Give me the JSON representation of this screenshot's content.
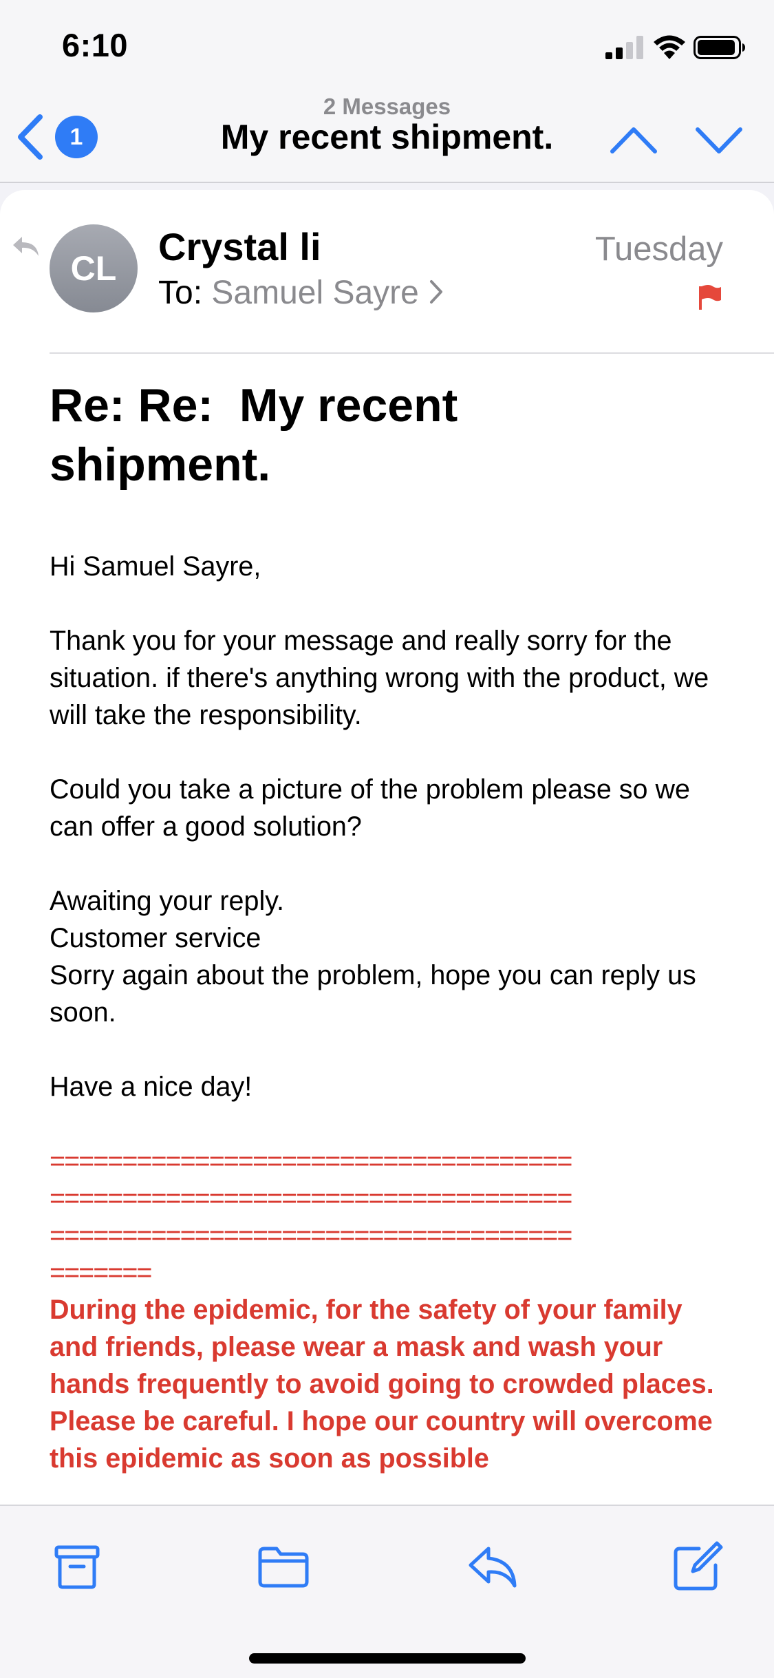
{
  "status_bar": {
    "time": "6:10",
    "signal_icon": "cellular-signal-icon",
    "wifi_icon": "wifi-icon",
    "battery_icon": "battery-icon"
  },
  "nav": {
    "back_badge": "1",
    "subtitle": "2 Messages",
    "title": "My recent shipment.",
    "up_icon": "chevron-up-icon",
    "down_icon": "chevron-down-icon"
  },
  "message": {
    "avatar_initials": "CL",
    "sender": "Crystal li",
    "to_label": "To: ",
    "recipient": "Samuel Sayre",
    "date": "Tuesday",
    "flagged": true,
    "subject": "Re: Re:  My recent shipment.",
    "body": {
      "greeting": "Hi Samuel Sayre,",
      "para1": "Thank you for your message and really sorry for the situation. if there's anything wrong with the product, we will take the responsibility.",
      "para2": "Could you take a picture of the problem please so we can offer a good solution?",
      "line_awaiting": "Awaiting your reply.",
      "line_service": "Customer service",
      "line_sorry": "Sorry again about the problem, hope you can reply us soon.",
      "sign_off": "Have a nice day!",
      "separator_1": "====================================",
      "separator_2": "====================================",
      "separator_3": "====================================",
      "separator_4": "=======",
      "epidemic_note": "During the epidemic, for the safety of your family and friends, please wear a mask and wash your hands frequently to avoid going to crowded places. Please be careful. I hope our country will overcome this epidemic as soon as possible"
    }
  },
  "toolbar": {
    "archive_icon": "archive-icon",
    "move_icon": "folder-icon",
    "reply_icon": "reply-icon",
    "compose_icon": "compose-icon"
  },
  "colors": {
    "accent": "#2f7cf6",
    "flag": "#e5483b",
    "quote_red": "#d93a30",
    "secondary_text": "#8a8a8e"
  }
}
